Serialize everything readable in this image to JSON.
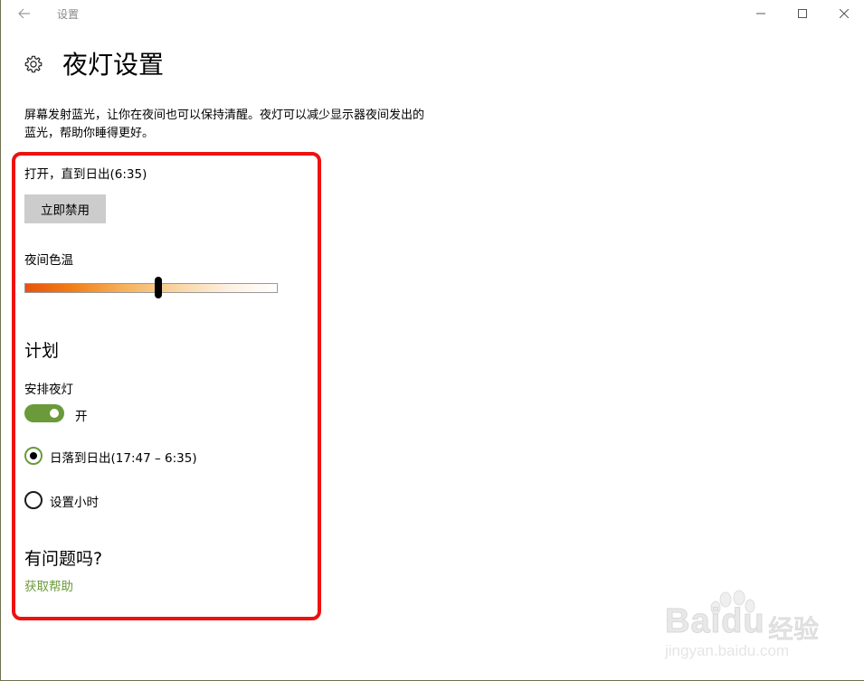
{
  "window": {
    "title": "设置"
  },
  "header": {
    "title": "夜灯设置",
    "icon": "gear-icon"
  },
  "description": "屏幕发射蓝光，让你在夜间也可以保持清醒。夜灯可以减少显示器夜间发出的蓝光，帮助你睡得更好。",
  "night_light": {
    "status": "打开，直到日出(6:35)",
    "disable_button": "立即禁用",
    "temperature_label": "夜间色温",
    "temperature_level": 0.53
  },
  "schedule": {
    "heading": "计划",
    "label": "安排夜灯",
    "toggle_state": "开",
    "toggle_on": true,
    "options": [
      {
        "label": "日落到日出(17:47 – 6:35)",
        "selected": true
      },
      {
        "label": "设置小时",
        "selected": false
      }
    ]
  },
  "help": {
    "heading": "有问题吗?",
    "link": "获取帮助"
  },
  "watermark": {
    "brand": "Baidu",
    "cn": "经验",
    "url": "jingyan.baidu.com"
  },
  "colors": {
    "accent": "#6b9a3a",
    "highlight_border": "#ee1111",
    "button_bg": "#cccccc"
  }
}
